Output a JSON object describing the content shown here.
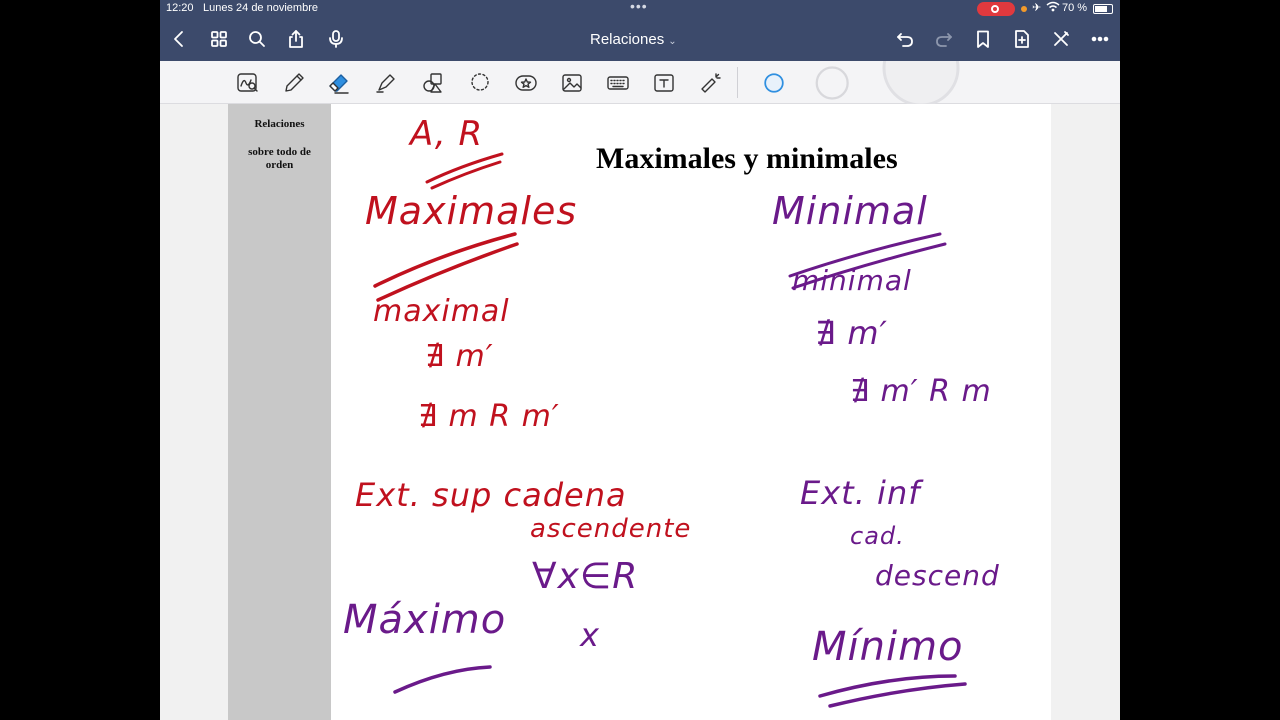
{
  "status_bar": {
    "time": "12:20",
    "date": "Lunes 24 de noviembre",
    "battery": "70 %"
  },
  "nav": {
    "title": "Relaciones",
    "left_icons": [
      "back-icon",
      "thumbnails-icon",
      "search-icon",
      "share-icon",
      "microphone-icon"
    ],
    "right_icons": [
      "undo-icon",
      "redo-icon",
      "bookmark-icon",
      "add-page-icon",
      "close-pen-icon",
      "more-icon"
    ]
  },
  "toolbar": {
    "tools": [
      "lasso-zoom-tool",
      "pen-tool",
      "eraser-tool",
      "highlighter-tool",
      "shapes-tool",
      "lasso-tool",
      "elements-tool",
      "image-tool",
      "keyboard-tool",
      "text-tool",
      "laser-tool"
    ],
    "selected_tool": "eraser-tool",
    "eraser_sizes": [
      "small",
      "medium",
      "large"
    ],
    "colors": {
      "nav": "#3c4a6b",
      "accent": "#2f8fe0"
    }
  },
  "document": {
    "sidebar_title": "Relaciones",
    "sidebar_subtitle": "sobre todo de orden",
    "heading": "Maximales y minimales"
  },
  "handwriting": {
    "colors": {
      "left": "#c0111e",
      "right": "#6a1a8a"
    },
    "left": [
      "A, R",
      "Maximales",
      "maximal",
      "∄ m′",
      "∄ m R m′",
      "Ext. sup cadena",
      "ascendente",
      "∀x∈R",
      "x",
      "Máximo"
    ],
    "right": [
      "Minimal",
      "minimal",
      "∄ m′",
      "∄ m′ R m",
      "Ext. inf",
      "cad.",
      "descend",
      "Mínimo"
    ]
  }
}
